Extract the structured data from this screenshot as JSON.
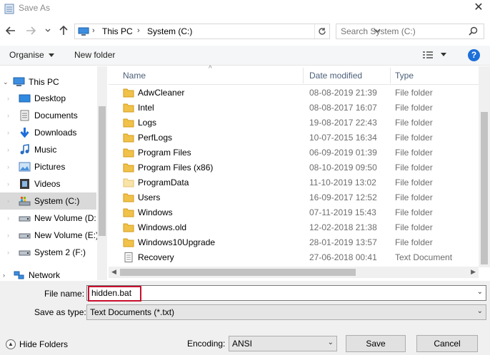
{
  "window": {
    "title": "Save As",
    "close_glyph": "✕"
  },
  "nav": {
    "back_icon": "arrow-left-icon",
    "forward_icon": "arrow-right-icon",
    "recent_icon": "chevron-down-icon",
    "up_icon": "arrow-up-icon",
    "breadcrumbs": [
      "This PC",
      "System (C:)"
    ],
    "search_placeholder": "Search System (C:)"
  },
  "toolbar": {
    "organise_label": "Organise",
    "new_folder_label": "New folder",
    "help_label": "?"
  },
  "sidebar": {
    "items": [
      {
        "label": "This PC",
        "icon": "computer-icon",
        "level": "top",
        "selected": false
      },
      {
        "label": "Desktop",
        "icon": "desktop-icon",
        "level": "child",
        "selected": false
      },
      {
        "label": "Documents",
        "icon": "documents-icon",
        "level": "child",
        "selected": false
      },
      {
        "label": "Downloads",
        "icon": "download-icon",
        "level": "child",
        "selected": false
      },
      {
        "label": "Music",
        "icon": "music-icon",
        "level": "child",
        "selected": false
      },
      {
        "label": "Pictures",
        "icon": "pictures-icon",
        "level": "child",
        "selected": false
      },
      {
        "label": "Videos",
        "icon": "videos-icon",
        "level": "child",
        "selected": false
      },
      {
        "label": "System (C:)",
        "icon": "system-drive-icon",
        "level": "child",
        "selected": true
      },
      {
        "label": "New Volume (D:",
        "icon": "drive-icon",
        "level": "child",
        "selected": false
      },
      {
        "label": "New Volume (E:)",
        "icon": "drive-icon",
        "level": "child",
        "selected": false
      },
      {
        "label": "System 2 (F:)",
        "icon": "drive-icon",
        "level": "child",
        "selected": false
      },
      {
        "label": "Network",
        "icon": "network-icon",
        "level": "top",
        "selected": false
      }
    ]
  },
  "list": {
    "columns": {
      "name": "Name",
      "date": "Date modified",
      "type": "Type"
    },
    "rows": [
      {
        "name": "AdwCleaner",
        "date": "08-08-2019 21:39",
        "type": "File folder",
        "kind": "folder"
      },
      {
        "name": "Intel",
        "date": "08-08-2017 16:07",
        "type": "File folder",
        "kind": "folder"
      },
      {
        "name": "Logs",
        "date": "19-08-2017 22:43",
        "type": "File folder",
        "kind": "folder"
      },
      {
        "name": "PerfLogs",
        "date": "10-07-2015 16:34",
        "type": "File folder",
        "kind": "folder"
      },
      {
        "name": "Program Files",
        "date": "06-09-2019 01:39",
        "type": "File folder",
        "kind": "folder"
      },
      {
        "name": "Program Files (x86)",
        "date": "08-10-2019 09:50",
        "type": "File folder",
        "kind": "folder"
      },
      {
        "name": "ProgramData",
        "date": "11-10-2019 13:02",
        "type": "File folder",
        "kind": "folder-light"
      },
      {
        "name": "Users",
        "date": "16-09-2017 12:52",
        "type": "File folder",
        "kind": "folder"
      },
      {
        "name": "Windows",
        "date": "07-11-2019 15:43",
        "type": "File folder",
        "kind": "folder"
      },
      {
        "name": "Windows.old",
        "date": "12-02-2018 21:38",
        "type": "File folder",
        "kind": "folder"
      },
      {
        "name": "Windows10Upgrade",
        "date": "28-01-2019 13:57",
        "type": "File folder",
        "kind": "folder"
      },
      {
        "name": "Recovery",
        "date": "27-06-2018 00:41",
        "type": "Text Document",
        "kind": "text"
      }
    ]
  },
  "form": {
    "filename_label": "File name:",
    "filename_value": "hidden.bat",
    "savetype_label": "Save as type:",
    "savetype_value": "Text Documents (*.txt)",
    "encoding_label": "Encoding:",
    "encoding_value": "ANSI",
    "hide_folders_label": "Hide Folders",
    "save_label": "Save",
    "cancel_label": "Cancel"
  },
  "colors": {
    "folder": "#f0c24a",
    "accent": "#1e6fd9",
    "highlight": "#c8102e",
    "selected": "#d9d9d9"
  }
}
